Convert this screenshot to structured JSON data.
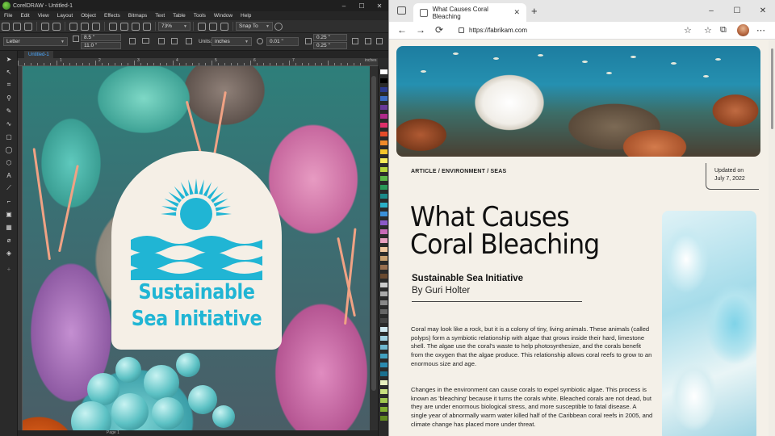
{
  "corel": {
    "window_title": "CorelDRAW - Untitled-1",
    "window_controls": [
      "–",
      "☐",
      "✕"
    ],
    "menu": [
      "File",
      "Edit",
      "View",
      "Layout",
      "Object",
      "Effects",
      "Bitmaps",
      "Text",
      "Table",
      "Tools",
      "Window",
      "Help"
    ],
    "toolbar": {
      "zoom": "73%",
      "snap": "Snap To"
    },
    "property_bar": {
      "page_size": "Letter",
      "width": "8.5 \"",
      "height": "11.0 \"",
      "units_label": "Units:",
      "units": "inches",
      "nudge": "0.01 \"",
      "dup_x": "0.25 \"",
      "dup_y": "0.25 \""
    },
    "document_tab": "Untitled-1",
    "ruler_units": "inches",
    "ruler_labels": [
      "1",
      "2",
      "3",
      "4",
      "5",
      "6",
      "7"
    ],
    "status_page": "Page 1",
    "artwork": {
      "line1": "Sustainable",
      "line2": "Sea Initiative",
      "brand_color": "#20b5d4"
    },
    "palette_colors": [
      "#ffffff",
      "#000000",
      "#2b3a8f",
      "#3b6cc4",
      "#6a3a9a",
      "#b02a8a",
      "#e0306a",
      "#e44c2a",
      "#f08a2a",
      "#f5c52a",
      "#f7ec5a",
      "#b6d63a",
      "#5ab848",
      "#2a9a5a",
      "#1a8a8a",
      "#2ab0c8",
      "#3a90d8",
      "#8a5ac8",
      "#c86ab8",
      "#e8a0c0",
      "#f0c8a0",
      "#c8a070",
      "#9a7050",
      "#6a4a30",
      "#cccccc",
      "#aaaaaa",
      "#888888",
      "#666666",
      "#444444",
      "#d0e8f0",
      "#a0d0e0",
      "#70b8d0",
      "#40a0c0",
      "#2a8ab0",
      "#1a7090",
      "#e8f0c0",
      "#c8e080",
      "#a0c850",
      "#80b030",
      "#608a20"
    ]
  },
  "browser": {
    "tab_title": "What Causes Coral Bleaching",
    "tab_close": "✕",
    "new_tab": "+",
    "window_controls": [
      "–",
      "☐",
      "✕"
    ],
    "url": "https://fabrikam.com",
    "nav": {
      "back": "←",
      "forward": "→",
      "refresh": "⟳"
    },
    "toolbar_icons": {
      "favorite": "☆",
      "favorites_bar": "☆",
      "collections": "⧉",
      "menu": "⋯"
    }
  },
  "article": {
    "breadcrumb": "ARTICLE / ENVIRONMENT / SEAS",
    "updated_label": "Updated on",
    "updated_date": "July 7, 2022",
    "title_line1": "What Causes",
    "title_line2": "Coral Bleaching",
    "organization": "Sustainable Sea Initiative",
    "byline": "By Guri Holter",
    "paragraph1": "Coral may look like a rock, but it is a colony of tiny, living animals. These animals (called polyps) form a symbiotic relationship with algae that grows inside their hard, limestone shell. The algae use the coral's waste to help photosynthesize, and the corals benefit from the oxygen that the algae produce. This relationship allows coral reefs to grow to an enormous size and age.",
    "paragraph2": "Changes in the environment can cause corals to expel symbiotic algae. This process is known as 'bleaching' because it turns the corals white. Bleached corals are not dead, but they are under enormous biological stress, and more susceptible to fatal disease. A single year of abnormally warm water killed half of the Caribbean coral reefs in 2005, and climate change has placed more under threat."
  }
}
